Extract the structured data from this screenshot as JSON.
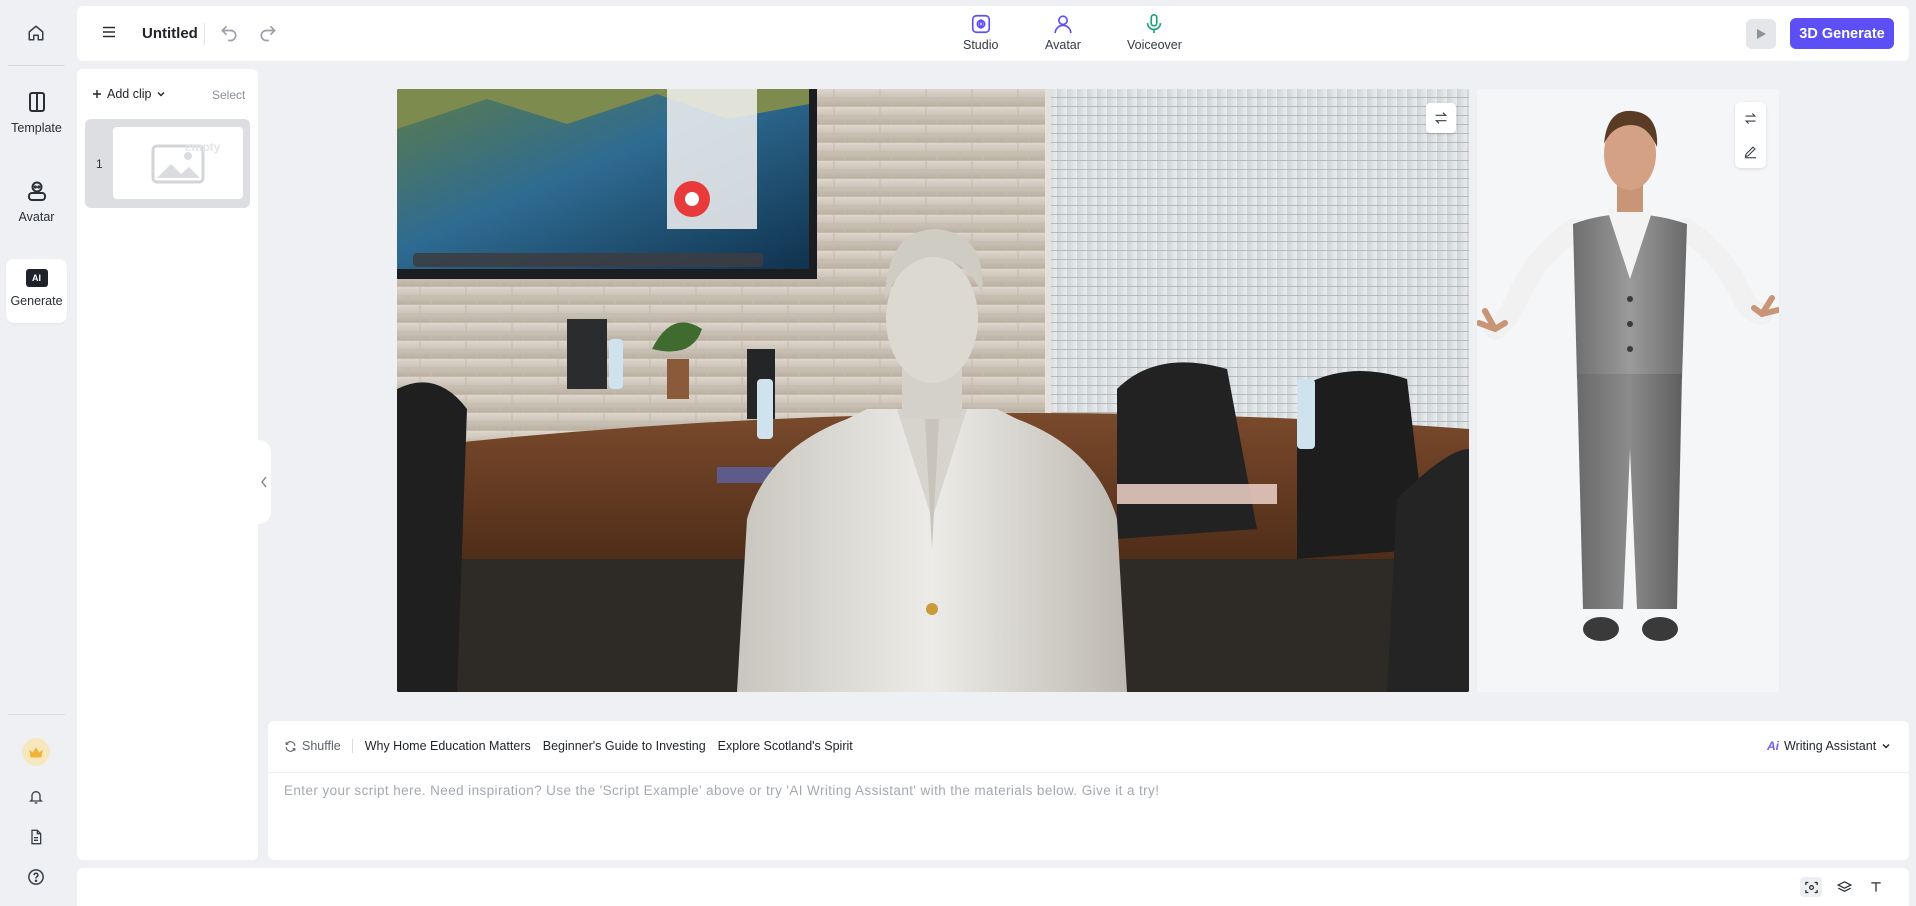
{
  "rail": {
    "items": [
      {
        "label": "Template"
      },
      {
        "label": "Avatar"
      },
      {
        "label": "Generate"
      }
    ],
    "generate_badge": "AI"
  },
  "topbar": {
    "title": "Untitled",
    "tabs": [
      {
        "label": "Studio"
      },
      {
        "label": "Avatar"
      },
      {
        "label": "Voiceover"
      }
    ],
    "generate_label": "3D Generate"
  },
  "clips": {
    "add_label": "Add clip",
    "select_label": "Select",
    "items": [
      {
        "number": "1",
        "thumb_text": "empty"
      }
    ]
  },
  "script": {
    "shuffle_label": "Shuffle",
    "suggestions": [
      "Why Home Education Matters",
      "Beginner's Guide to Investing",
      "Explore Scotland's Spirit"
    ],
    "assistant_label": "Writing Assistant",
    "assistant_badge": "Ai",
    "placeholder": "Enter your script here. Need inspiration? Use the 'Script Example' above or try 'AI Writing Assistant' with the materials below. Give it a try!"
  },
  "colors": {
    "accent": "#5b4ff5",
    "background": "#eef0f3",
    "crown": "#f2b233"
  }
}
